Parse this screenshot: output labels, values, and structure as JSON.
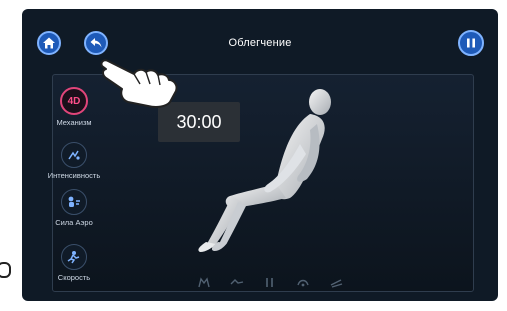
{
  "header": {
    "title": "Облегчение",
    "home_icon": "home-icon",
    "back_icon": "back-arrow-icon",
    "pause_icon": "pause-icon"
  },
  "timer": {
    "value": "30:00"
  },
  "left_menu": {
    "items": [
      {
        "id": "mechanism",
        "label": "Механизм",
        "icon": "4d-mechanism-icon",
        "icon_text": "4D"
      },
      {
        "id": "intensity",
        "label": "Интенсивность",
        "icon": "intensity-icon"
      },
      {
        "id": "air",
        "label": "Сила Аэро",
        "icon": "air-pressure-icon"
      },
      {
        "id": "speed",
        "label": "Скорость",
        "icon": "speed-icon"
      }
    ]
  },
  "position_icons": [
    "recline-position-1-icon",
    "recline-position-2-icon",
    "recline-position-3-icon",
    "recline-position-4-icon",
    "recline-position-5-icon"
  ],
  "colors": {
    "screen_bg": "#0f1a26",
    "accent": "#1e5ab8",
    "active": "#e0457a"
  }
}
